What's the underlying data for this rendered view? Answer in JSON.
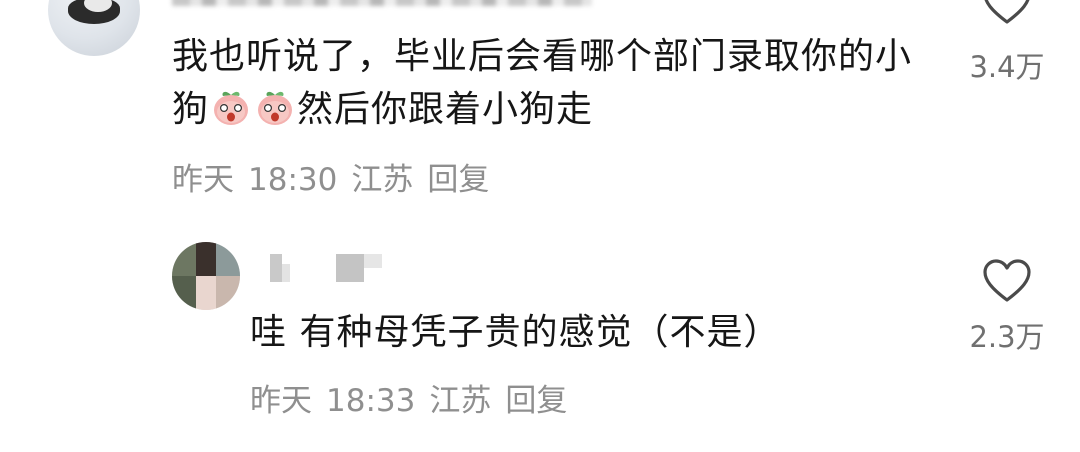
{
  "comments": [
    {
      "text_before": "我也听说了，毕业后会看哪个部门录取你的小狗",
      "emoji": "peach-face-emoji",
      "text_after": "然后你跟着小狗走",
      "date": "昨天",
      "time": "18:30",
      "location": "江苏",
      "reply_label": "回复",
      "like_count": "3.4万"
    },
    {
      "text": "哇 有种母凭子贵的感觉（不是）",
      "date": "昨天",
      "time": "18:33",
      "location": "江苏",
      "reply_label": "回复",
      "like_count": "2.3万"
    }
  ],
  "colors": {
    "text": "#161616",
    "meta": "#8f8f8f",
    "like_count": "#707070",
    "heart_outline": "#4a4a4a",
    "emoji_face": "#f2a7a7",
    "emoji_leaf": "#5aa35a"
  }
}
